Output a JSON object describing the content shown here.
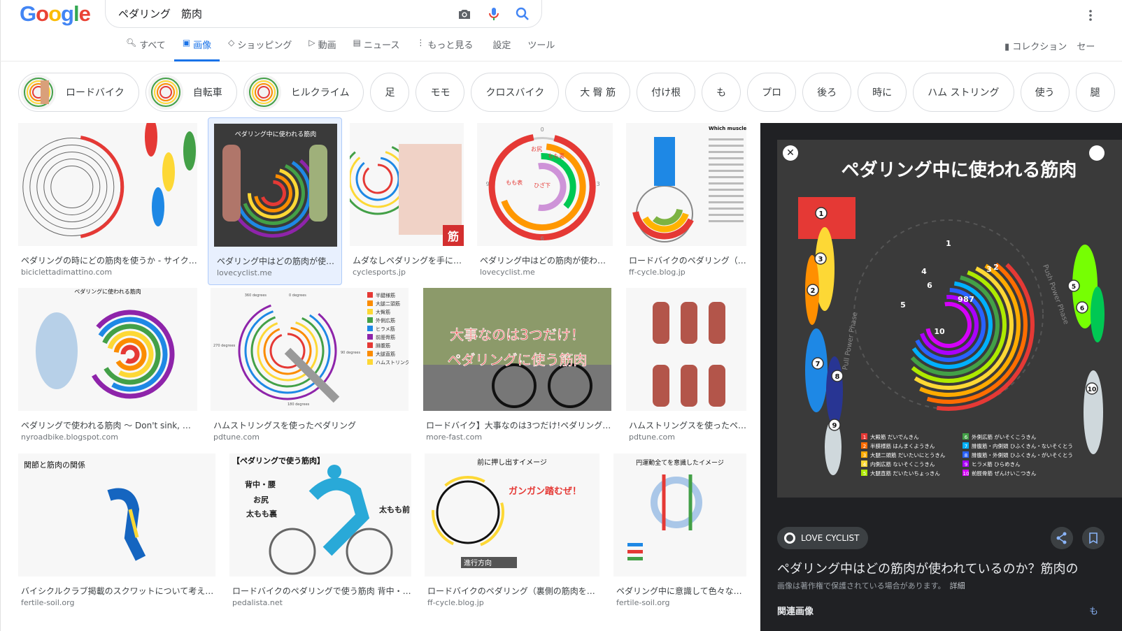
{
  "logo": {
    "letters": [
      {
        "c": "G",
        "color": "#4285F4"
      },
      {
        "c": "o",
        "color": "#EA4335"
      },
      {
        "c": "o",
        "color": "#FBBC05"
      },
      {
        "c": "g",
        "color": "#4285F4"
      },
      {
        "c": "l",
        "color": "#34A853"
      },
      {
        "c": "e",
        "color": "#EA4335"
      }
    ]
  },
  "search": {
    "query": "ペダリング　筋肉",
    "icons": [
      "camera-icon",
      "mic-icon",
      "search-icon"
    ]
  },
  "nav": {
    "tabs": [
      {
        "label": "すべて",
        "icon": "search-icon"
      },
      {
        "label": "画像",
        "icon": "image-icon",
        "active": true
      },
      {
        "label": "ショッピング",
        "icon": "tag-icon"
      },
      {
        "label": "動画",
        "icon": "play-icon"
      },
      {
        "label": "ニュース",
        "icon": "news-icon"
      },
      {
        "label": "もっと見る",
        "icon": "more-vert-icon"
      },
      {
        "label": "設定"
      },
      {
        "label": "ツール"
      }
    ],
    "collection": "コレクション",
    "safesearch": "セー"
  },
  "chips": [
    {
      "label": "ロードバイク",
      "img": true
    },
    {
      "label": "自転車",
      "img": true
    },
    {
      "label": "ヒルクライム",
      "img": true
    },
    {
      "label": "足"
    },
    {
      "label": "モモ"
    },
    {
      "label": "クロスバイク"
    },
    {
      "label": "大 臀 筋"
    },
    {
      "label": "付け根"
    },
    {
      "label": "も"
    },
    {
      "label": "プロ"
    },
    {
      "label": "後ろ"
    },
    {
      "label": "時に"
    },
    {
      "label": "ハム ストリング"
    },
    {
      "label": "使う"
    },
    {
      "label": "腿"
    }
  ],
  "results": [
    {
      "title": "ペダリングの時にどの筋肉を使うか - サイク…",
      "source": "biciclettadimattino.com"
    },
    {
      "title": "ペダリング中はどの筋肉が使…",
      "source": "lovecyclist.me",
      "overlay": "ペダリング中に使われる筋肉"
    },
    {
      "title": "ムダなしペダリングを手に…",
      "source": "cyclesports.jp",
      "overlay": "筋"
    },
    {
      "title": "ペダリング中はどの筋肉が使わ…",
      "source": "lovecyclist.me",
      "labels": [
        "0",
        "3",
        "6",
        "9",
        "お尻",
        "もも裏",
        "もも表",
        "ひざ下"
      ]
    },
    {
      "title": "ロードバイクのペダリング（…",
      "source": "ff-cycle.blog.jp",
      "overlay": "Which muscles do the work"
    },
    {
      "title": "ペダリングで使われる筋肉 〜 Don't sink, wh…",
      "source": "nyroadbike.blogspot.com",
      "overlay": "ペダリングに使われる筋肉"
    },
    {
      "title": "ハムストリングスを使ったペダリング",
      "source": "pdtune.com",
      "labels": [
        "360 degrees",
        "0 degrees",
        "270 degrees",
        "90 degrees",
        "180 degrees"
      ],
      "legend": [
        "半腱様筋",
        "大腿二頭筋",
        "大臀筋",
        "外側広筋",
        "ヒラメ筋",
        "前脛骨筋",
        "腓腹筋",
        "大腿直筋",
        "ハムストリングス"
      ]
    },
    {
      "title": "ロードバイク】大事なのは3つだけ!ペダリング…",
      "source": "more-fast.com",
      "overlay": "大事なのは3つだけ！",
      "overlay2": "ペダリングに使う筋肉"
    },
    {
      "title": "ハムストリングスを使ったペ…",
      "source": "pdtune.com"
    },
    {
      "title": "バイシクルクラブ掲載のスクワットについて考え…",
      "source": "fertile-soil.org",
      "overlay": "関節と筋肉の関係"
    },
    {
      "title": "ロードバイクのペダリングで使う筋肉 背中・…",
      "source": "pedalista.net",
      "overlay": "【ペダリングで使う筋肉】",
      "labels": [
        "背中・腰",
        "お尻",
        "太もも裏",
        "太もも前"
      ]
    },
    {
      "title": "ロードバイクのペダリング（裏側の筋肉を…",
      "source": "ff-cycle.blog.jp",
      "overlay": "前に押し出すイメージ",
      "overlay2": "ガンガン踏むぜ！",
      "overlay3": "進行方向"
    },
    {
      "title": "ペダリング中に意識して色々な…",
      "source": "fertile-soil.org",
      "overlay": "円運動全てを意識したイメージ"
    }
  ],
  "panel": {
    "image_title": "ペダリング中に使われる筋肉",
    "numbers": [
      "1",
      "2",
      "3",
      "4",
      "5",
      "6",
      "7",
      "8",
      "9",
      "10"
    ],
    "legend": [
      "大殿筋 だいでんきん",
      "半膜様筋 はんまくようきん",
      "大腿二頭筋 だいたいにとうきん",
      "内側広筋 ないそくこうきん",
      "大腿直筋 だいたいちょっきん",
      "外側広筋 がいそくこうきん",
      "腓腹筋・内側頭 ひふくきん・ないそくとう",
      "腓腹筋・外側頭 ひふくきん・がいそくとう",
      "ヒラメ筋 ひらめきん",
      "前脛骨筋 ぜんけいこつきん"
    ],
    "side_labels": [
      "Push Power Phase",
      "Pull Power Phase"
    ],
    "source": "LOVE CYCLIST",
    "title": "ペダリング中はどの筋肉が使われているのか？筋肉の",
    "note": "画像は著作権で保護されている場合があります。",
    "details": "詳細",
    "related": "関連画像",
    "more": "も"
  },
  "colors": {
    "accent": "#1a73e8",
    "ring": [
      "#e53935",
      "#fb8c00",
      "#fdd835",
      "#43a047",
      "#1e88e5",
      "#8e24aa"
    ]
  }
}
